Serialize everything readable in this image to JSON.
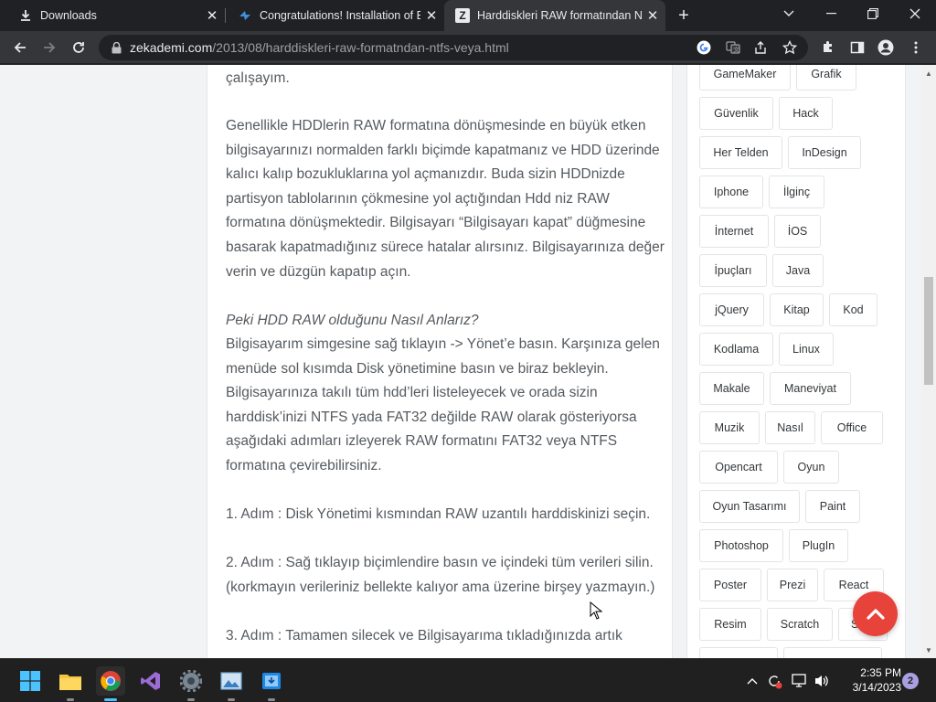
{
  "browser": {
    "tabs": [
      {
        "label": "Downloads",
        "icon": "download-icon",
        "active": false
      },
      {
        "label": "Congratulations! Installation of Eclipse",
        "icon": "eclipse-installer-icon",
        "active": false
      },
      {
        "label": "Harddiskleri RAW formatından NTFS",
        "icon": "zekademi-favicon",
        "active": true
      }
    ],
    "url_host": "zekademi.com",
    "url_path": "/2013/08/harddiskleri-raw-formatndan-ntfs-veya.html"
  },
  "article": {
    "lines_intro": "çalışayım.",
    "para1": "Genellikle HDDlerin RAW formatına dönüşmesinde en büyük etken bilgisayarınızı normalden farklı biçimde kapatmanız ve HDD üzerinde kalıcı kalıp bozukluklarına yol açmanızdır. Buda sizin HDDnizde partisyon tablolarının çökmesine yol açtığından Hdd niz RAW formatına dönüşmektedir. Bilgisayarı “Bilgisayarı kapat” düğmesine basarak kapatmadığınız sürece hatalar alırsınız. Bilgisayarınıza değer verin ve düzgün kapatıp açın.",
    "heading": "Peki HDD RAW olduğunu Nasıl Anlarız?",
    "para2": "Bilgisayarım simgesine sağ tıklayın -> Yönet’e basın. Karşınıza gelen menüde sol kısımda Disk yönetimine basın ve biraz bekleyin. Bilgisayarınıza takılı tüm hdd’leri listeleyecek ve orada sizin harddisk’inizi NTFS yada FAT32 değilde RAW olarak gösteriyorsa aşağıdaki adımları izleyerek RAW formatını FAT32 veya NTFS formatına çevirebilirsiniz.",
    "step1": "1. Adım : Disk Yönetimi kısmından RAW uzantılı harddiskinizi seçin.",
    "step2": "2. Adım : Sağ tıklayıp biçimlendire basın ve içindeki tüm verileri silin. (korkmayın verileriniz bellekte kalıyor ama üzerine birşey yazmayın.)",
    "step3": "3. Adım : Tamamen silecek ve Bilgisayarıma tıkladığınızda artık"
  },
  "tags": [
    "GameMaker",
    "Grafik",
    "Güvenlik",
    "Hack",
    "Her Telden",
    "InDesign",
    "Iphone",
    "İlginç",
    "İnternet",
    "İOS",
    "İpuçları",
    "Java",
    "jQuery",
    "Kitap",
    "Kod",
    "Kodlama",
    "Linux",
    "Makale",
    "Maneviyat",
    "Muzik",
    "Nasıl",
    "Office",
    "Opencart",
    "Oyun",
    "Oyun Tasarımı",
    "Paint",
    "Photoshop",
    "PlugIn",
    "Poster",
    "Prezi",
    "React",
    "Resim",
    "Scratch",
    "Sc"
  ],
  "taskbar": {
    "time": "2:35 PM",
    "date": "3/14/2023",
    "notifications": "2"
  }
}
